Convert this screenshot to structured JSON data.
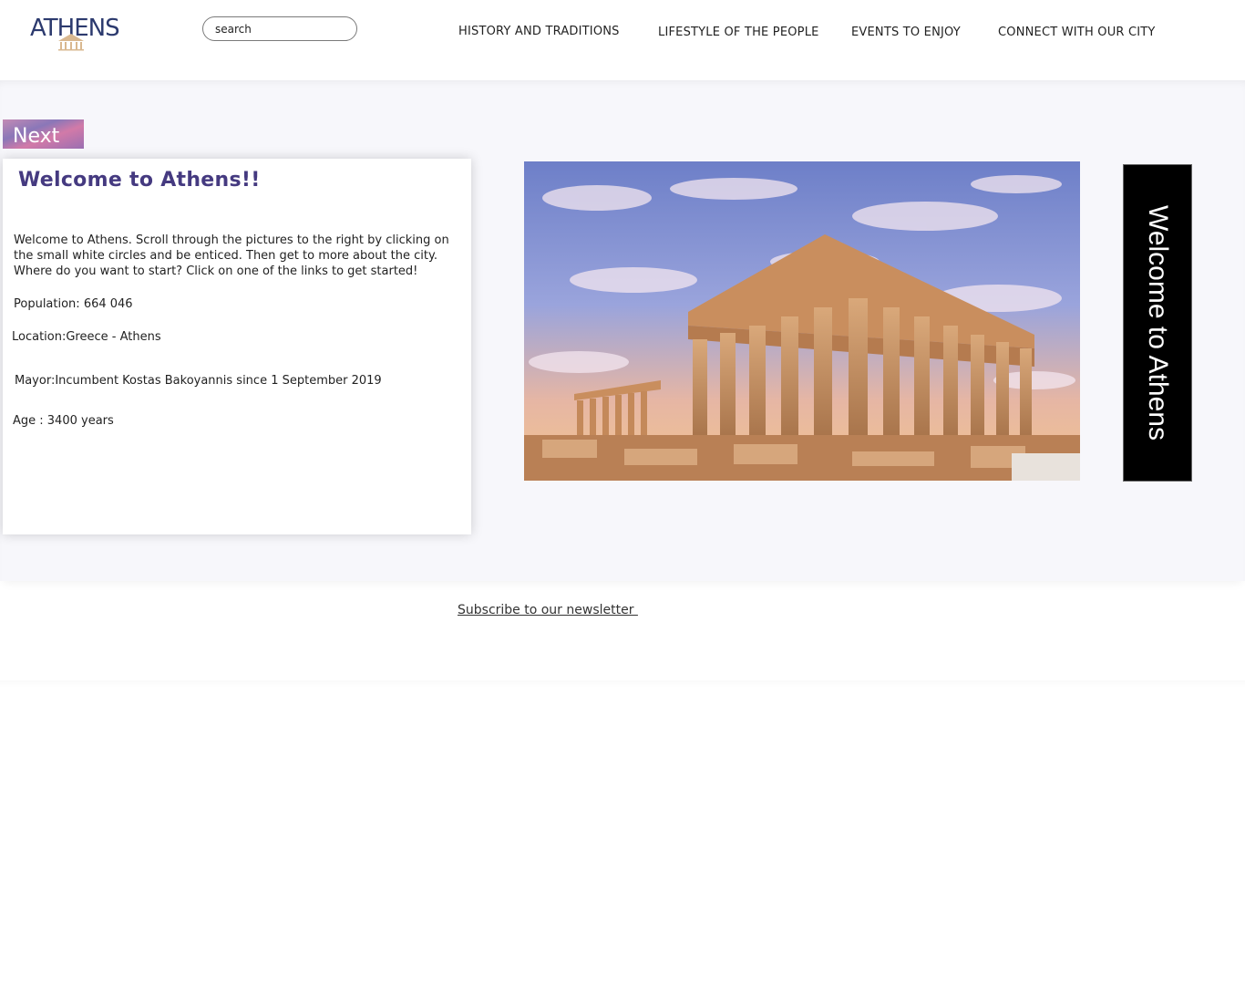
{
  "header": {
    "logo_text": "ATHENS",
    "search_value": "search"
  },
  "nav": {
    "items": [
      "HISTORY AND TRADITIONS",
      "LIFESTYLE OF THE PEOPLE",
      "EVENTS TO ENJOY",
      "CONNECT WITH OUR CITY"
    ]
  },
  "main": {
    "next_label": "Next",
    "card": {
      "title": "Welcome to Athens!!",
      "intro": "Welcome to Athens. Scroll through the pictures to the right by clicking on the small white circles and be enticed. Then get to more about the city. Where do you want to start? Click on one of the links to get started!",
      "population": "Population: 664 046",
      "location": "Location:Greece - Athens",
      "mayor": "Mayor:Incumbent Kostas Bakoyannis since 1 September 2019",
      "age": "Age : 3400 years"
    },
    "side_banner": "Welcome to Athens"
  },
  "footer": {
    "subscribe": "Subscribe to our newsletter "
  },
  "colors": {
    "title": "#453a80",
    "logo": "#2c3a6e",
    "band": "#f7f7fb"
  }
}
